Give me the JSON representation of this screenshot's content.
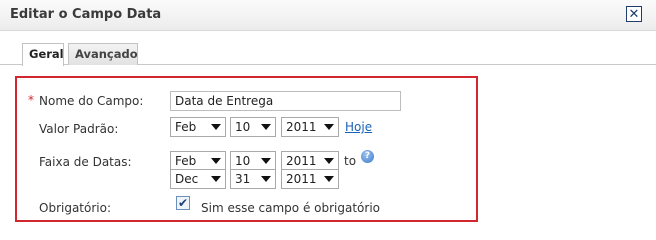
{
  "dialog": {
    "title": "Editar o Campo Data",
    "close_icon": "close-icon"
  },
  "tabs": [
    {
      "label": "Geral",
      "active": true
    },
    {
      "label": "Avançado",
      "active": false
    }
  ],
  "form": {
    "nome": {
      "required_mark": "*",
      "label": "Nome do Campo:",
      "value": "Data de Entrega"
    },
    "valor_padrao": {
      "label": "Valor Padrão:",
      "month": "Feb",
      "day": "10",
      "year": "2011",
      "today_link": "Hoje"
    },
    "faixa": {
      "label": "Faixa de Datas:",
      "start": {
        "month": "Feb",
        "day": "10",
        "year": "2011"
      },
      "to_label": "to",
      "end": {
        "month": "Dec",
        "day": "31",
        "year": "2011"
      },
      "help_icon": "help-icon"
    },
    "obrigatorio": {
      "label": "Obrigatório:",
      "checked": true,
      "checkbox_label": "Sim esse campo é obrigatório"
    }
  },
  "colors": {
    "highlight_border": "#d0282e",
    "link": "#1a62b8",
    "close_border": "#1f3d6b"
  }
}
